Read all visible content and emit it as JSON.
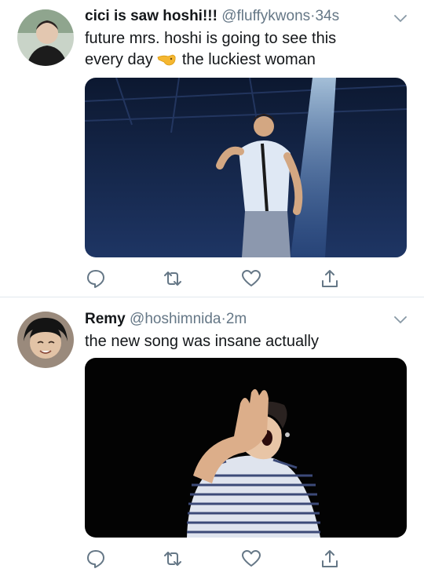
{
  "tweets": [
    {
      "name": "cici is saw hoshi!!!",
      "handle": "@fluffykwons",
      "sep": "·",
      "time": "34s",
      "text_line1": "future mrs. hoshi is going to see this",
      "text_line2_a": "every day",
      "text_line2_b": "the luckiest woman",
      "emoji": "hand-pointing-to-face",
      "media": "concert performer on stage under spotlight"
    },
    {
      "name": "Remy",
      "handle": "@hoshimnida",
      "sep": "·",
      "time": "2m",
      "text_line1": "the new song was insane actually",
      "media": "performer covering eye with hand, striped shirt"
    }
  ],
  "actions": [
    "reply-icon",
    "retweet-icon",
    "like-icon",
    "share-icon"
  ],
  "colors": {
    "handle": "#657786",
    "icon": "#657786",
    "divider": "#e1e8ed"
  }
}
